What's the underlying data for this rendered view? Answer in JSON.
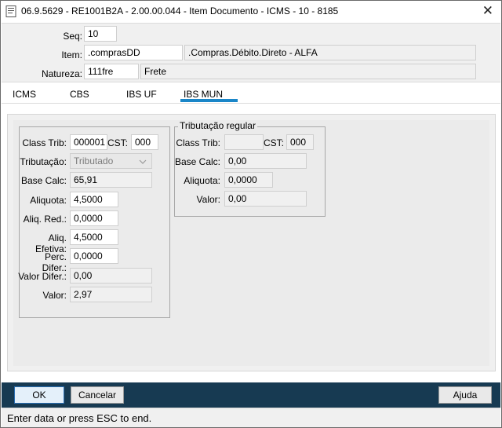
{
  "window": {
    "title": "06.9.5629 - RE1001B2A - 2.00.00.044 - Item Documento - ICMS - 10 - 8185",
    "close_glyph": "✕"
  },
  "header": {
    "seq_label": "Seq:",
    "seq_value": "10",
    "item_label": "Item:",
    "item_code": ".comprasDD",
    "item_desc": ".Compras.Débito.Direto - ALFA",
    "natureza_label": "Natureza:",
    "natureza_code": "111fre",
    "natureza_desc": "Frete"
  },
  "tabs": [
    {
      "label": "ICMS"
    },
    {
      "label": "CBS"
    },
    {
      "label": "IBS UF"
    },
    {
      "label": "IBS MUN"
    }
  ],
  "active_tab": "IBS MUN",
  "left_group": {
    "class_trib_label": "Class Trib:",
    "class_trib_value": "000001",
    "cst_label": "CST:",
    "cst_value": "000",
    "tributacao_label": "Tributação:",
    "tributacao_value": "Tributado",
    "base_calc_label": "Base Calc:",
    "base_calc_value": "65,91",
    "aliquota_label": "Aliquota:",
    "aliquota_value": "4,5000",
    "aliq_red_label": "Aliq. Red.:",
    "aliq_red_value": "0,0000",
    "aliq_efetiva_label": "Aliq. Efetiva:",
    "aliq_efetiva_value": "4,5000",
    "perc_difer_label": "Perc. Difer.:",
    "perc_difer_value": "0,0000",
    "valor_difer_label": "Valor Difer.:",
    "valor_difer_value": "0,00",
    "valor_label": "Valor:",
    "valor_value": "2,97"
  },
  "right_group": {
    "title": "Tributação regular",
    "class_trib_label": "Class Trib:",
    "class_trib_value": "",
    "cst_label": "CST:",
    "cst_value": "000",
    "base_calc_label": "Base Calc:",
    "base_calc_value": "0,00",
    "aliquota_label": "Aliquota:",
    "aliquota_value": "0,0000",
    "valor_label": "Valor:",
    "valor_value": "0,00"
  },
  "buttons": {
    "ok": "OK",
    "cancelar": "Cancelar",
    "ajuda": "Ajuda"
  },
  "status": {
    "text": "Enter data or press ESC to end."
  },
  "colors": {
    "accent": "#1a86c8",
    "bottom_bar": "#173a52"
  }
}
